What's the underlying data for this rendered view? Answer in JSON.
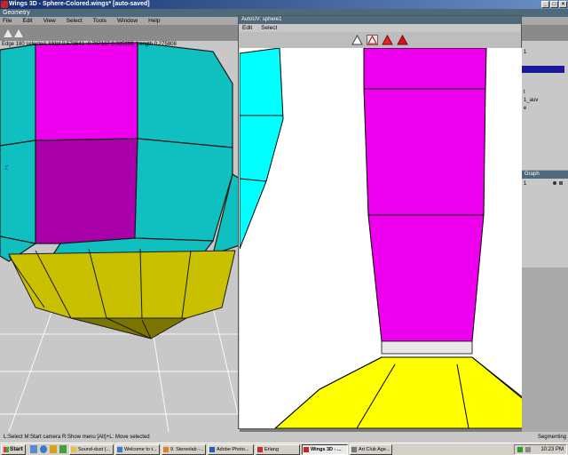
{
  "window": {
    "title": "Wings 3D - Sphere-Colored.wings* [auto-saved]"
  },
  "geometry_window": {
    "title": "Geometry"
  },
  "menu": {
    "items": [
      "File",
      "Edit",
      "View",
      "Select",
      "Tools",
      "Window",
      "Help"
    ]
  },
  "info_line": "Edge 180 selected, Mdpt 0.578641 -0.707107 0.385299, Length 0.275808",
  "viewport": {
    "axis_label": "Z"
  },
  "autouv": {
    "title": "AutoUV: sphere1",
    "menu": [
      "Edit",
      "Select"
    ]
  },
  "outliner": {
    "rows": [
      "1",
      "",
      "t",
      "1_auv",
      "e"
    ]
  },
  "graph": {
    "title": "Graph",
    "row": "1"
  },
  "statusbar": {
    "hint": "L:Select  M:Start camera  R:Show menu  [Alt]+L: Move selected",
    "mode": "Segmenting"
  },
  "taskbar": {
    "start_label": "Start",
    "tasks": [
      "Sound-dust (...",
      "Welcome to t...",
      "9. Stereolab -...",
      "Adobe Photo...",
      "Erlang",
      "Wings 3D - ...",
      "Art Club Age..."
    ],
    "clock": "10:23 PM"
  },
  "colors": {
    "magenta": "#ee00ee",
    "teal": "#10c0c0",
    "olive_yellow": "#c8c000",
    "yellow": "#ffff00",
    "cyan": "#00ffff",
    "title_bar": "#14306e"
  }
}
